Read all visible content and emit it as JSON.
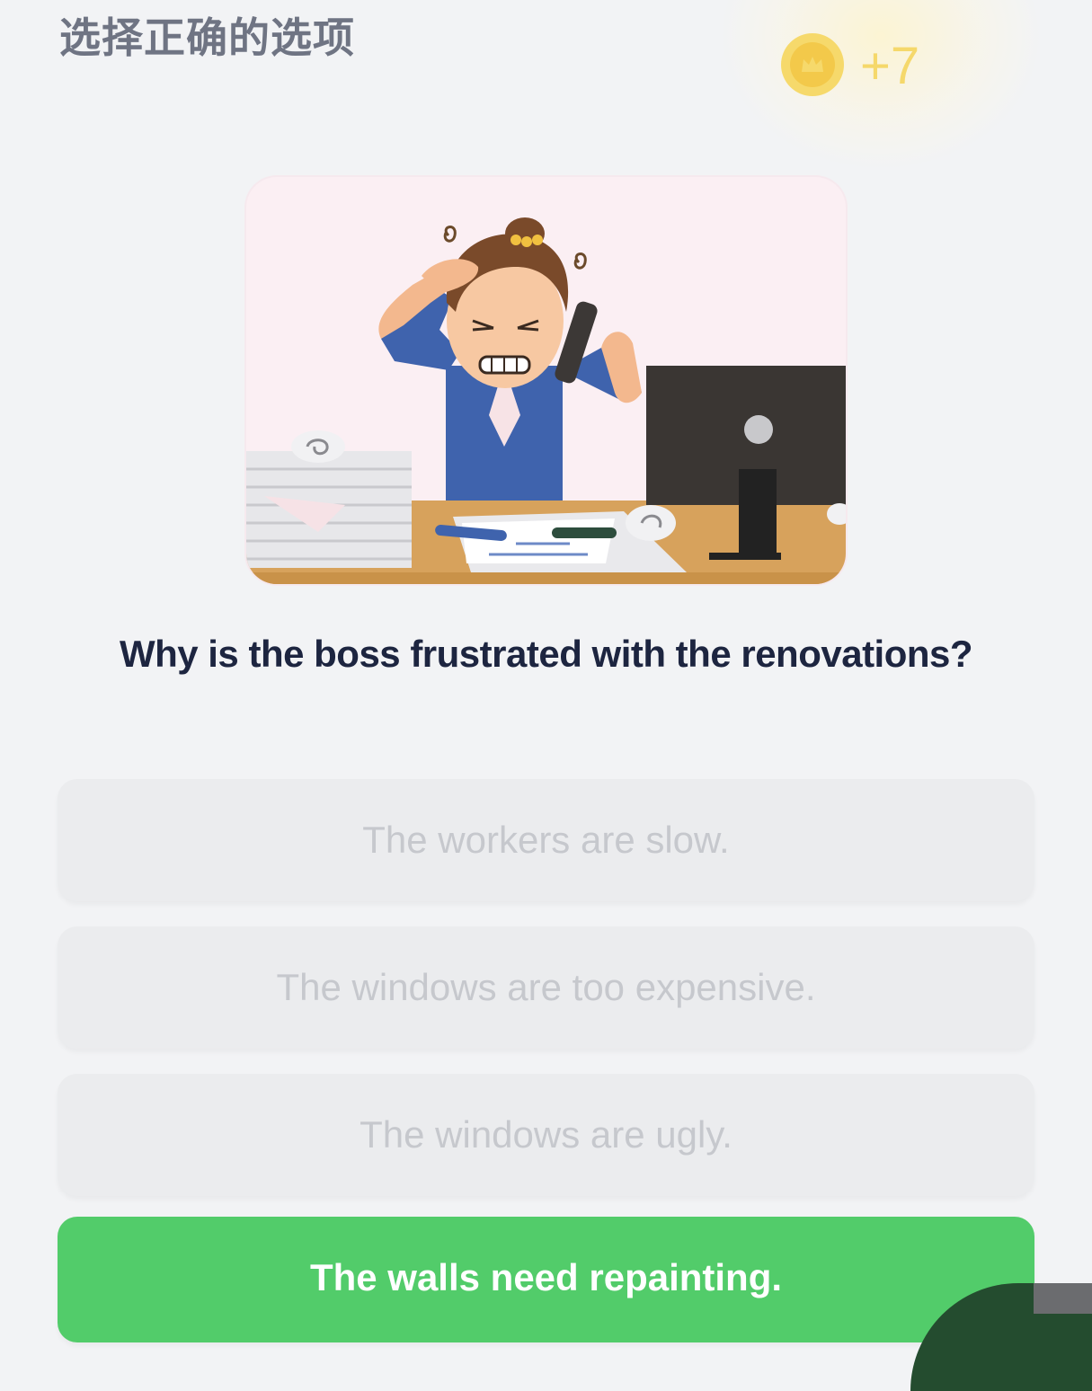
{
  "header": {
    "instruction": "选择正确的选项",
    "reward": "+7",
    "reward_icon": "crown-coin-icon",
    "reward_color": "#f5d86b"
  },
  "illustration": {
    "subject": "frustrated-boss-illustration"
  },
  "question": "Why is the boss frustrated with the renovations?",
  "options": [
    {
      "label": "The workers are slow.",
      "state": "disabled"
    },
    {
      "label": "The windows are too expensive.",
      "state": "disabled"
    },
    {
      "label": "The windows are ugly.",
      "state": "disabled"
    },
    {
      "label": "The walls need repainting.",
      "state": "correct"
    }
  ],
  "colors": {
    "background": "#f2f3f5",
    "correct": "#52cc6a",
    "question_text": "#1d2540",
    "disabled_text": "#c6c8cd"
  }
}
